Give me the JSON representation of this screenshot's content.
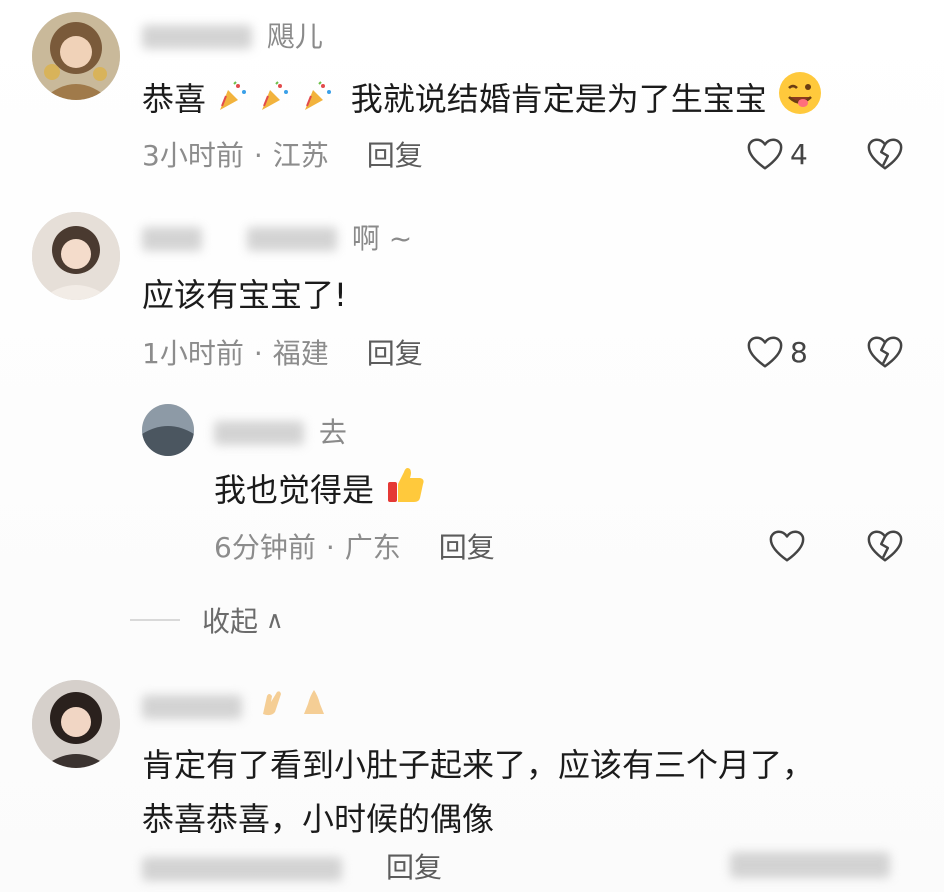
{
  "comments": [
    {
      "name_tail": "飓儿",
      "text": "恭喜",
      "text_after": "我就说结婚肯定是为了生宝宝",
      "time": "3小时前",
      "location": "江苏",
      "reply": "回复",
      "likes": "4"
    },
    {
      "name_tail": "啊 ~",
      "text": "应该有宝宝了!",
      "time": "1小时前",
      "location": "福建",
      "reply": "回复",
      "likes": "8"
    },
    {
      "name_tail": "去",
      "text": "我也觉得是",
      "time": "6分钟前",
      "location": "广东",
      "reply": "回复",
      "likes": ""
    },
    {
      "name_tail": "",
      "text_line1": "肯定有了看到小肚子起来了，应该有三个月了，",
      "text_line2": "恭喜恭喜，小时候的偶像",
      "reply": "回复"
    }
  ],
  "collapse_label": "收起",
  "collapse_chevron": "∧",
  "meta_separator": "·",
  "colors": {
    "text": "#1b1b1b",
    "meta": "#8c8c8c",
    "icon": "#444444"
  },
  "icons": [
    "heart-outline-icon",
    "broken-heart-icon",
    "party-popper-emoji",
    "wink-tongue-emoji",
    "thumbs-up-emoji",
    "clap-emoji"
  ]
}
